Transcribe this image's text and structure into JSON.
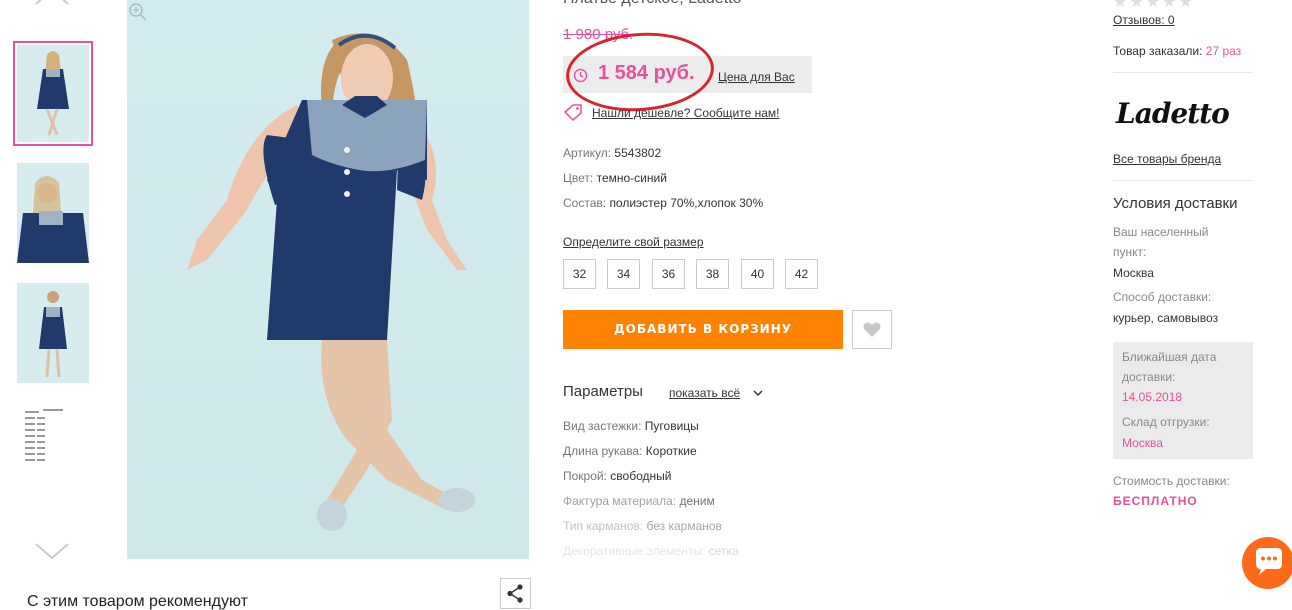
{
  "product": {
    "title": "Платье детское, Ladetto",
    "old_price": "1 980 руб.",
    "price": "1 584 руб.",
    "price_note": "Цена для Вас",
    "cheaper_link": "Нашли дешевле? Сообщите нам!",
    "attributes": [
      {
        "key": "Артикул:",
        "value": "5543802"
      },
      {
        "key": "Цвет:",
        "value": "темно-синий"
      },
      {
        "key": "Состав:",
        "value": "полиэстер 70%,хлопок 30%"
      }
    ],
    "size_link": "Определите свой размер",
    "sizes": [
      "32",
      "34",
      "36",
      "38",
      "40",
      "42"
    ],
    "add_to_cart": "ДОБАВИТЬ В КОРЗИНУ",
    "params_title": "Параметры",
    "params_show_all": "показать всё",
    "params": [
      {
        "key": "Вид застежки:",
        "value": "Пуговицы"
      },
      {
        "key": "Длина рукава:",
        "value": "Короткие"
      },
      {
        "key": "Покрой:",
        "value": "свободный"
      },
      {
        "key": "Фактура материала:",
        "value": "деним"
      },
      {
        "key": "Тип карманов:",
        "value": "без карманов"
      },
      {
        "key": "Декоративные элементы:",
        "value": "сетка"
      }
    ]
  },
  "recommend_title": "С этим товаром рекомендуют",
  "sidebar": {
    "stars": "★★★★★",
    "reviews": "Отзывов: 0",
    "ordered_label": "Товар заказали:",
    "ordered_count": "27 раз",
    "brand_logo": "Ladetto",
    "brand_link": "Все товары бренда",
    "delivery_title": "Условия доставки",
    "locality_label_1": "Ваш населенный",
    "locality_label_2": "пункт:",
    "locality_value": "Москва",
    "method_label": "Способ доставки:",
    "method_value": "курьер, самовывоз",
    "nearest_label_1": "Ближайшая дата",
    "nearest_label_2": "доставки:",
    "nearest_value": "14.05.2018",
    "warehouse_label": "Склад отгрузки:",
    "warehouse_value": "Москва",
    "cost_label": "Стоимость доставки:",
    "cost_value": "БЕСПЛАТНО"
  },
  "colors": {
    "accent_pink": "#e94f9a",
    "cart_orange": "#ff8200",
    "highlight_red": "#d8242f",
    "dress_navy": "#1f3a6b"
  }
}
